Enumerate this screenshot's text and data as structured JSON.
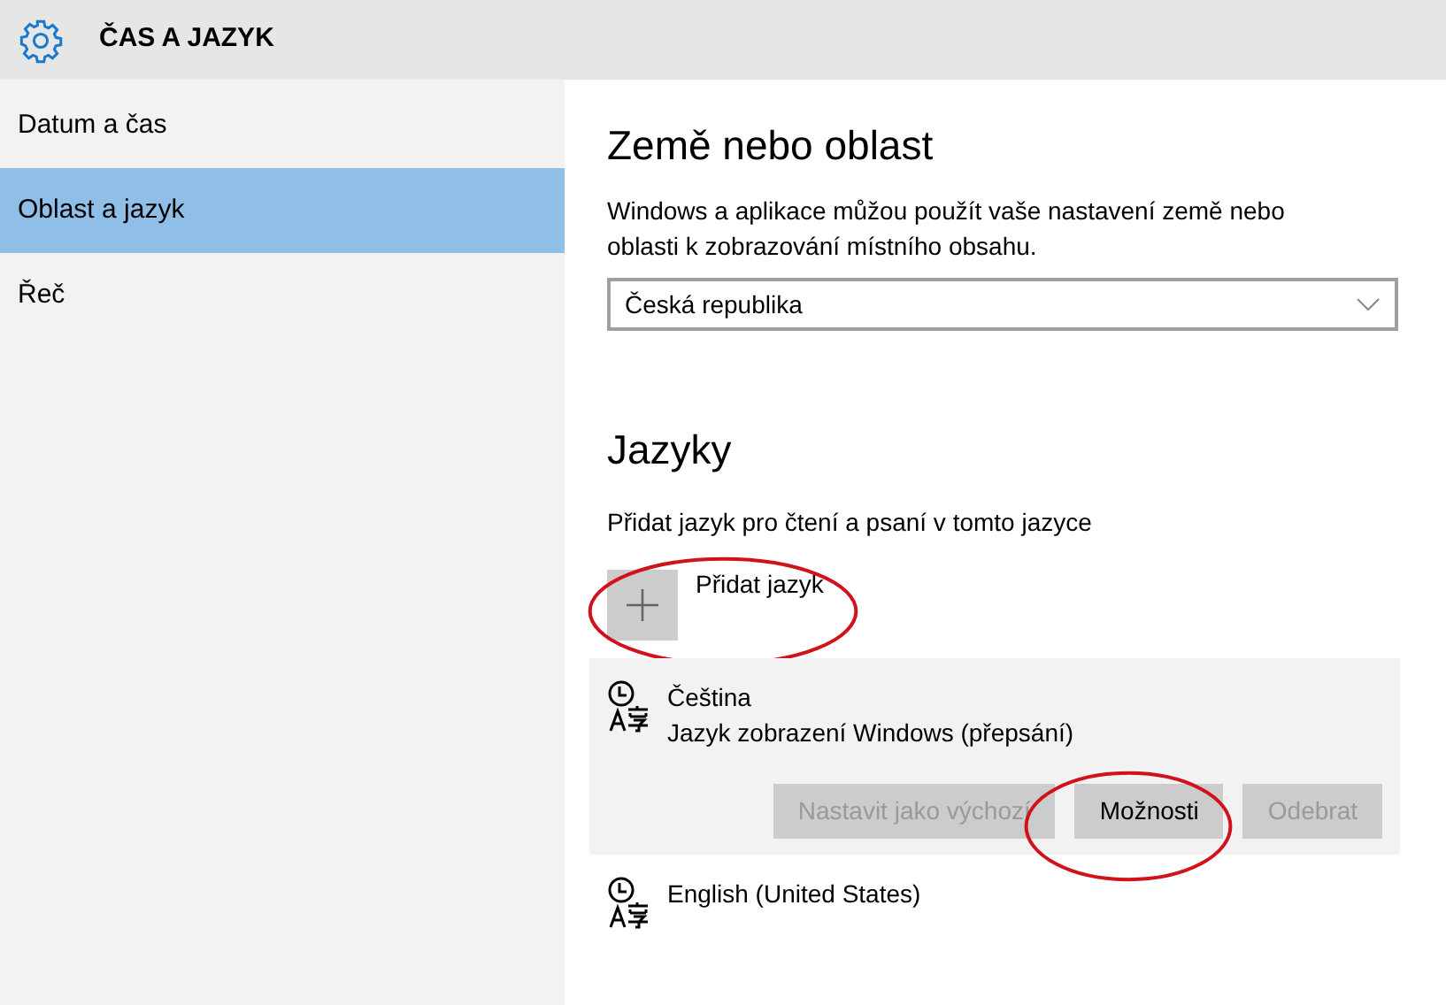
{
  "header": {
    "title": "ČAS A JAZYK"
  },
  "sidebar": {
    "items": [
      {
        "label": "Datum a čas",
        "selected": false
      },
      {
        "label": "Oblast a jazyk",
        "selected": true
      },
      {
        "label": "Řeč",
        "selected": false
      }
    ]
  },
  "region": {
    "heading": "Země nebo oblast",
    "description": "Windows a aplikace můžou použít vaše nastavení země nebo oblasti k zobrazování místního obsahu.",
    "dropdown": {
      "value": "Česká republika"
    }
  },
  "languages": {
    "heading": "Jazyky",
    "description": "Přidat jazyk pro čtení a psaní v tomto jazyce",
    "add": {
      "label": "Přidat jazyk",
      "circled": true
    },
    "items": [
      {
        "name": "Čeština",
        "detail": "Jazyk zobrazení Windows (přepsání)",
        "expanded": true,
        "buttons": [
          {
            "label": "Nastavit jako výchozí",
            "disabled": true,
            "circled": false
          },
          {
            "label": "Možnosti",
            "disabled": false,
            "circled": true
          },
          {
            "label": "Odebrat",
            "disabled": true,
            "circled": false
          }
        ]
      },
      {
        "name": "English (United States)",
        "expanded": false
      }
    ]
  }
}
